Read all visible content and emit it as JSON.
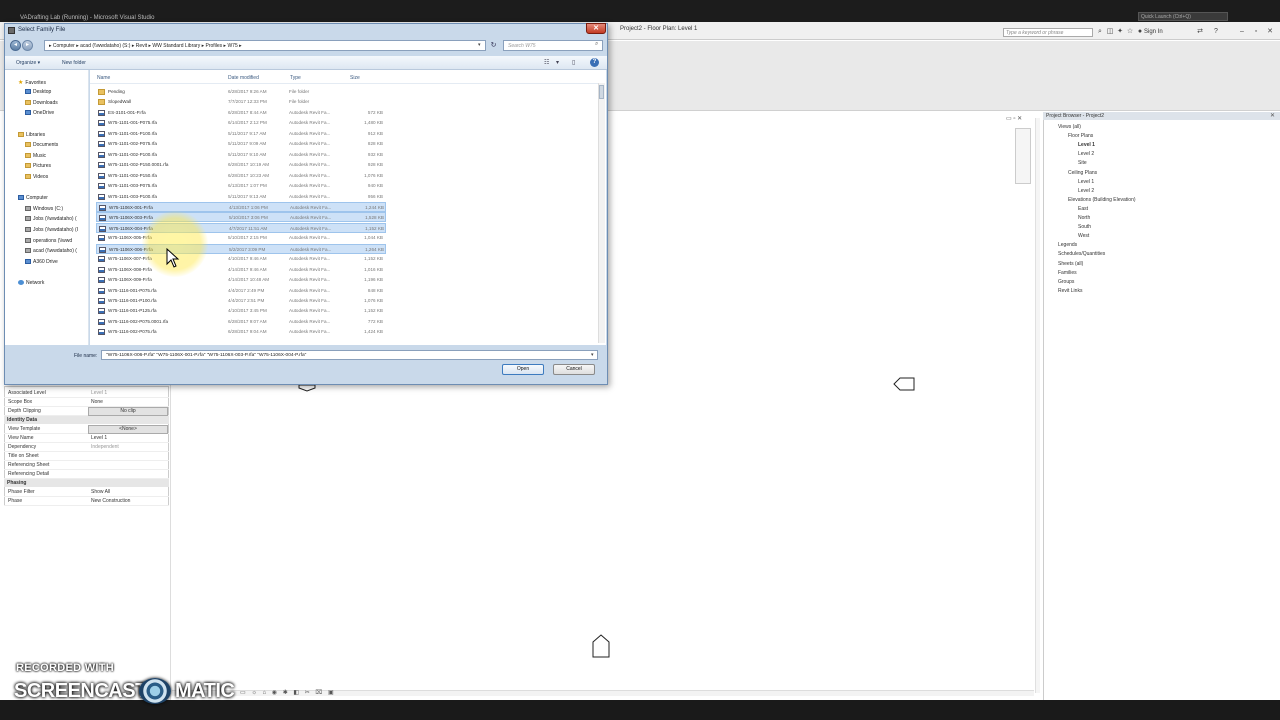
{
  "vs_window": {
    "title": "VADrafting Lab (Running) - Microsoft Visual Studio"
  },
  "revit": {
    "title": "Project2 - Floor Plan: Level 1",
    "search_placeholder": "Type a keyword or phrase",
    "sign_in": "Sign In",
    "quick_launch": "Quick Launch (Ctrl+Q)"
  },
  "dialog": {
    "title": "Select Family File",
    "address": "▸ Computer ▸ acad (\\\\wwdataho) (S:) ▸ Revit ▸ WW Standard Library ▸ Profiles ▸ W75 ▸",
    "search_placeholder": "Search W75",
    "toolbar": {
      "organize": "Organize ▾",
      "new_folder": "New folder"
    },
    "columns": {
      "name": "Name",
      "date": "Date modified",
      "type": "Type",
      "size": "Size"
    },
    "nav": {
      "favorites": "Favorites",
      "desktop": "Desktop",
      "downloads": "Downloads",
      "onedrive": "OneDrive",
      "libraries": "Libraries",
      "documents": "Documents",
      "music": "Music",
      "pictures": "Pictures",
      "videos": "Videos",
      "computer": "Computer",
      "windows": "Windows (C:)",
      "jobs1": "Jobs (\\\\wwdataho) (",
      "jobs2": "Jobs (\\\\wwdataho) (I",
      "operations": "operations (\\\\wwd",
      "acad": "acad (\\\\wwdataho) (",
      "a360": "A360 Drive",
      "network": "Network"
    },
    "files": [
      {
        "name": "Pending",
        "date": "6/28/2017 9:26 AM",
        "type": "File folder",
        "size": "",
        "kind": "folder",
        "selected": false
      },
      {
        "name": "SlopedWall",
        "date": "7/7/2017 12:33 PM",
        "type": "File folder",
        "size": "",
        "kind": "folder",
        "selected": false
      },
      {
        "name": "ES-3101-001-P.rfa",
        "date": "6/28/2017 8:44 AM",
        "type": "Autodesk Revit Fa...",
        "size": "572 KB",
        "kind": "file",
        "selected": false
      },
      {
        "name": "W75-1101-001-P075.rfa",
        "date": "6/14/2017 2:12 PM",
        "type": "Autodesk Revit Fa...",
        "size": "1,480 KB",
        "kind": "file",
        "selected": false
      },
      {
        "name": "W75-1101-001-P100.rfa",
        "date": "5/11/2017 9:17 AM",
        "type": "Autodesk Revit Fa...",
        "size": "912 KB",
        "kind": "file",
        "selected": false
      },
      {
        "name": "W75-1101-002-P075.rfa",
        "date": "5/11/2017 9:09 AM",
        "type": "Autodesk Revit Fa...",
        "size": "828 KB",
        "kind": "file",
        "selected": false
      },
      {
        "name": "W75-1101-002-P100.rfa",
        "date": "5/11/2017 9:10 AM",
        "type": "Autodesk Revit Fa...",
        "size": "932 KB",
        "kind": "file",
        "selected": false
      },
      {
        "name": "W75-1101-002-P150.0001.rfa",
        "date": "6/28/2017 10:19 AM",
        "type": "Autodesk Revit Fa...",
        "size": "928 KB",
        "kind": "file",
        "selected": false
      },
      {
        "name": "W75-1101-002-P150.rfa",
        "date": "6/28/2017 10:23 AM",
        "type": "Autodesk Revit Fa...",
        "size": "1,076 KB",
        "kind": "file",
        "selected": false
      },
      {
        "name": "W75-1101-003-P075.rfa",
        "date": "6/13/2017 1:07 PM",
        "type": "Autodesk Revit Fa...",
        "size": "940 KB",
        "kind": "file",
        "selected": false
      },
      {
        "name": "W75-1101-003-P100.rfa",
        "date": "5/11/2017 9:13 AM",
        "type": "Autodesk Revit Fa...",
        "size": "956 KB",
        "kind": "file",
        "selected": false
      },
      {
        "name": "W75-1106X-001-P.rfa",
        "date": "4/13/2017 1:06 PM",
        "type": "Autodesk Revit Fa...",
        "size": "1,244 KB",
        "kind": "file",
        "selected": true
      },
      {
        "name": "W75-1106X-003-P.rfa",
        "date": "5/10/2017 3:06 PM",
        "type": "Autodesk Revit Fa...",
        "size": "1,528 KB",
        "kind": "file",
        "selected": true
      },
      {
        "name": "W75-1106X-004-P.rfa",
        "date": "4/7/2017 11:51 AM",
        "type": "Autodesk Revit Fa...",
        "size": "1,152 KB",
        "kind": "file",
        "selected": true
      },
      {
        "name": "W75-1106X-005-P.rfa",
        "date": "5/10/2017 2:15 PM",
        "type": "Autodesk Revit Fa...",
        "size": "1,044 KB",
        "kind": "file",
        "selected": false
      },
      {
        "name": "W75-1106X-006-P.rfa",
        "date": "5/2/2017 3:09 PM",
        "type": "Autodesk Revit Fa...",
        "size": "1,264 KB",
        "kind": "file",
        "selected": true
      },
      {
        "name": "W75-1106X-007-P.rfa",
        "date": "4/10/2017 9:46 AM",
        "type": "Autodesk Revit Fa...",
        "size": "1,152 KB",
        "kind": "file",
        "selected": false
      },
      {
        "name": "W75-1106X-008-P.rfa",
        "date": "4/14/2017 9:46 AM",
        "type": "Autodesk Revit Fa...",
        "size": "1,016 KB",
        "kind": "file",
        "selected": false
      },
      {
        "name": "W75-1106X-009-P.rfa",
        "date": "4/14/2017 10:48 AM",
        "type": "Autodesk Revit Fa...",
        "size": "1,196 KB",
        "kind": "file",
        "selected": false
      },
      {
        "name": "W75-1116-001-P075.rfa",
        "date": "4/4/2017 2:49 PM",
        "type": "Autodesk Revit Fa...",
        "size": "848 KB",
        "kind": "file",
        "selected": false
      },
      {
        "name": "W75-1116-001-P100.rfa",
        "date": "4/4/2017 2:51 PM",
        "type": "Autodesk Revit Fa...",
        "size": "1,076 KB",
        "kind": "file",
        "selected": false
      },
      {
        "name": "W75-1116-001-P125.rfa",
        "date": "4/10/2017 3:45 PM",
        "type": "Autodesk Revit Fa...",
        "size": "1,152 KB",
        "kind": "file",
        "selected": false
      },
      {
        "name": "W75-1116-002-P075.0001.rfa",
        "date": "6/28/2017 9:07 AM",
        "type": "Autodesk Revit Fa...",
        "size": "772 KB",
        "kind": "file",
        "selected": false
      },
      {
        "name": "W75-1116-002-P075.rfa",
        "date": "6/28/2017 9:04 AM",
        "type": "Autodesk Revit Fa...",
        "size": "1,424 KB",
        "kind": "file",
        "selected": false
      }
    ],
    "filename_label": "File name:",
    "filename_value": "\"W75-1106X-006-P.rfa\" \"W75-1106X-001-P.rfa\" \"W75-1106X-003-P.rfa\" \"W75-1106X-004-P.rfa\"",
    "open_label": "Open",
    "cancel_label": "Cancel"
  },
  "properties": {
    "rows": [
      {
        "k": "Associated Level",
        "v": "Level 1",
        "style": "grey"
      },
      {
        "k": "Scope Box",
        "v": "None",
        "style": ""
      },
      {
        "k": "Depth Clipping",
        "v": "No clip",
        "style": "btn"
      }
    ],
    "group_identity": "Identity Data",
    "identity_rows": [
      {
        "k": "View Template",
        "v": "<None>",
        "style": "btn"
      },
      {
        "k": "View Name",
        "v": "Level 1",
        "style": ""
      },
      {
        "k": "Dependency",
        "v": "Independent",
        "style": "grey"
      },
      {
        "k": "Title on Sheet",
        "v": "",
        "style": ""
      },
      {
        "k": "Referencing Sheet",
        "v": "",
        "style": ""
      },
      {
        "k": "Referencing Detail",
        "v": "",
        "style": ""
      }
    ],
    "group_phasing": "Phasing",
    "phasing_rows": [
      {
        "k": "Phase Filter",
        "v": "Show All",
        "style": ""
      },
      {
        "k": "Phase",
        "v": "New Construction",
        "style": ""
      }
    ]
  },
  "project_browser": {
    "title": "Project Browser - Project2",
    "items": [
      {
        "label": "Views (all)",
        "indent": 0,
        "bold": false
      },
      {
        "label": "Floor Plans",
        "indent": 1,
        "bold": false
      },
      {
        "label": "Level 1",
        "indent": 2,
        "bold": true
      },
      {
        "label": "Level 2",
        "indent": 2,
        "bold": false
      },
      {
        "label": "Site",
        "indent": 2,
        "bold": false
      },
      {
        "label": "Ceiling Plans",
        "indent": 1,
        "bold": false
      },
      {
        "label": "Level 1",
        "indent": 2,
        "bold": false
      },
      {
        "label": "Level 2",
        "indent": 2,
        "bold": false
      },
      {
        "label": "Elevations (Building Elevation)",
        "indent": 1,
        "bold": false
      },
      {
        "label": "East",
        "indent": 2,
        "bold": false
      },
      {
        "label": "North",
        "indent": 2,
        "bold": false
      },
      {
        "label": "South",
        "indent": 2,
        "bold": false
      },
      {
        "label": "West",
        "indent": 2,
        "bold": false
      },
      {
        "label": "Legends",
        "indent": 0,
        "bold": false
      },
      {
        "label": "Schedules/Quantities",
        "indent": 0,
        "bold": false
      },
      {
        "label": "Sheets (all)",
        "indent": 0,
        "bold": false
      },
      {
        "label": "Families",
        "indent": 0,
        "bold": false
      },
      {
        "label": "Groups",
        "indent": 0,
        "bold": false
      },
      {
        "label": "Revit Links",
        "indent": 0,
        "bold": false
      }
    ]
  },
  "watermark": {
    "line1": "RECORDED WITH",
    "line2a": "SCREENCAST",
    "line2b": "MATIC"
  }
}
